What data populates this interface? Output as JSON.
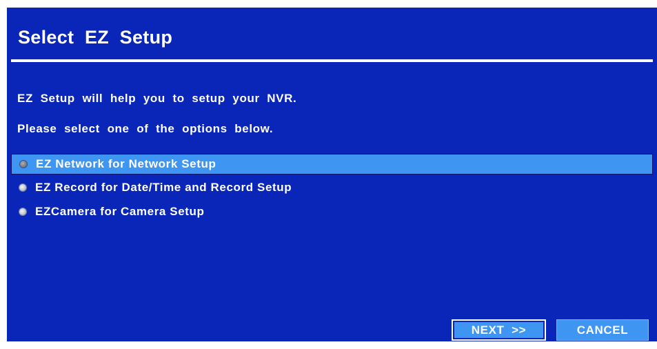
{
  "dialog": {
    "title": "Select  EZ  Setup",
    "intro_line_1": "EZ  Setup  will  help  you  to  setup  your  NVR.",
    "intro_line_2": "Please  select  one  of  the  options  below.",
    "options": [
      {
        "label": "EZ  Network  for  Network  Setup",
        "selected": true
      },
      {
        "label": "EZ  Record  for  Date/Time  and  Record  Setup",
        "selected": false
      },
      {
        "label": "EZCamera  for  Camera  Setup",
        "selected": false
      }
    ],
    "buttons": {
      "next_label": "NEXT  >>",
      "cancel_label": "CANCEL"
    }
  },
  "colors": {
    "dialog_background": "#0a26b8",
    "highlight": "#3f96f2",
    "text": "#ffffff"
  }
}
